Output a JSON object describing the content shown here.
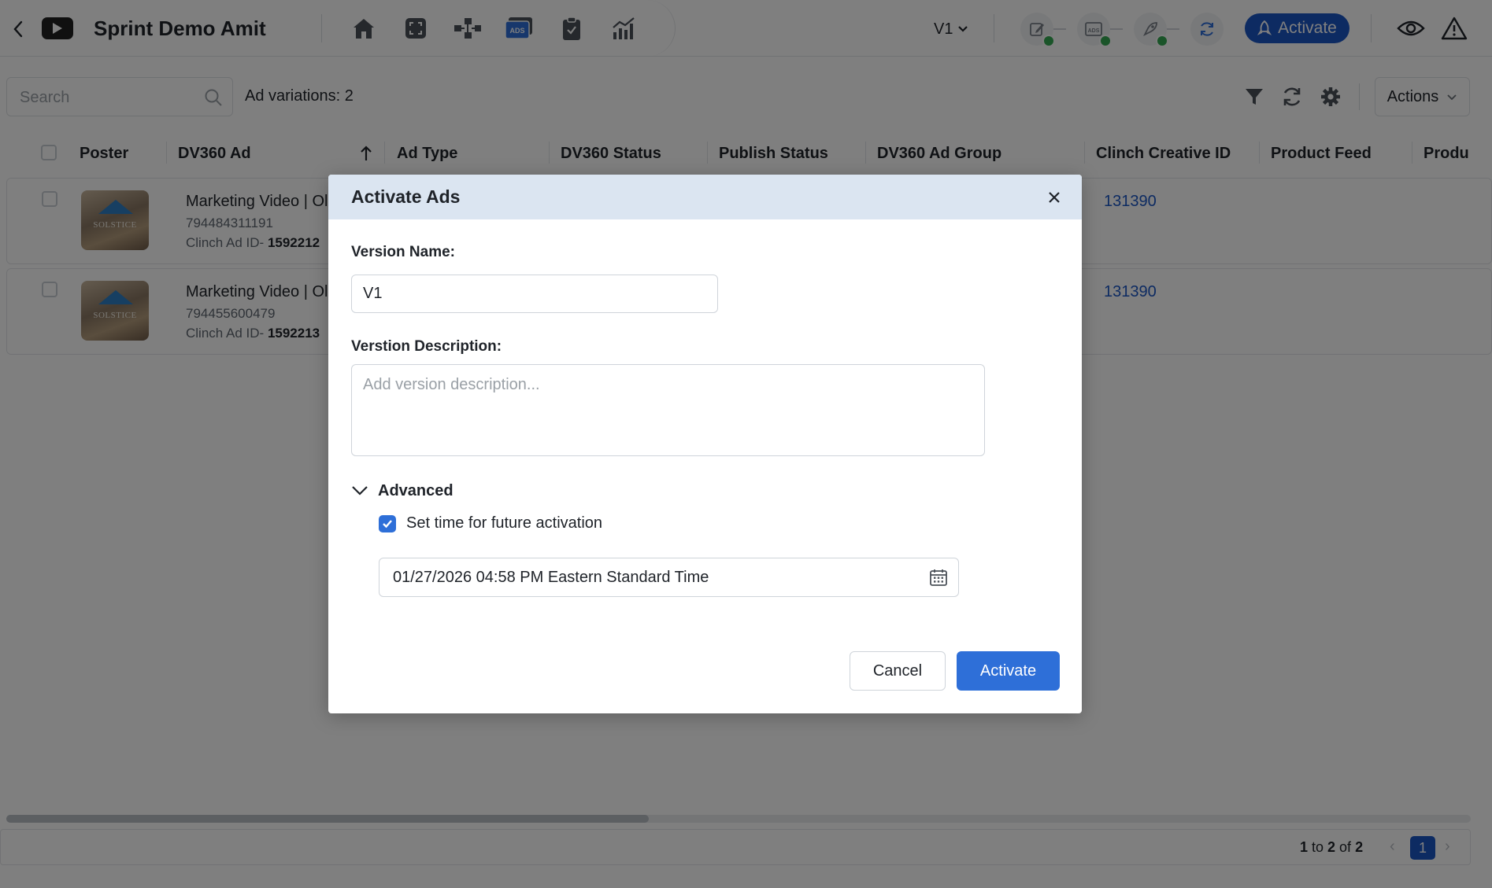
{
  "header": {
    "title": "Sprint Demo Amit",
    "version": "V1",
    "activate_label": "Activate",
    "nav_icons": [
      "home-icon",
      "expand-icon",
      "hierarchy-icon",
      "ads-icon",
      "clipboard-icon",
      "chart-icon"
    ]
  },
  "toolbar": {
    "search_placeholder": "Search",
    "variations_text": "Ad variations: 2",
    "actions_label": "Actions"
  },
  "grid": {
    "columns": [
      "Poster",
      "DV360 Ad",
      "Ad Type",
      "DV360 Status",
      "Publish Status",
      "DV360 Ad Group",
      "Clinch Creative ID",
      "Product Feed",
      "Produ"
    ],
    "rows": [
      {
        "poster_text": "SOLSTICE",
        "ad_name": "Marketing Video | Ol",
        "ad_id": "794484311191",
        "clinch_label": "Clinch Ad ID- ",
        "clinch_id": "1592212",
        "creative_id": "131390"
      },
      {
        "poster_text": "SOLSTICE",
        "ad_name": "Marketing Video | Ol",
        "ad_id": "794455600479",
        "clinch_label": "Clinch Ad ID- ",
        "clinch_id": "1592213",
        "creative_id": "131390"
      }
    ]
  },
  "pagination": {
    "from": "1",
    "to_label": " to ",
    "to": "2",
    "of_label": " of ",
    "total": "2",
    "current_page": "1"
  },
  "modal": {
    "title": "Activate Ads",
    "version_name_label": "Version Name:",
    "version_name_value": "V1",
    "description_label": "Verstion Description:",
    "description_placeholder": "Add version description...",
    "advanced_label": "Advanced",
    "future_activation_label": "Set time for future activation",
    "future_activation_checked": true,
    "datetime_value": "01/27/2026 04:58 PM Eastern Standard Time",
    "cancel_label": "Cancel",
    "activate_label": "Activate"
  },
  "colors": {
    "primary": "#1b56c5",
    "button_blue": "#2e6fd8",
    "modal_header": "#dbe5f1",
    "success": "#35a853"
  }
}
